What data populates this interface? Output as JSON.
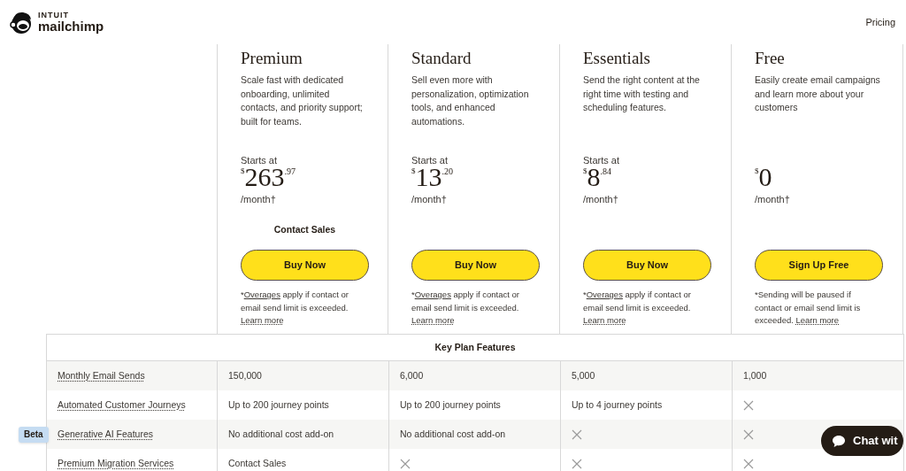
{
  "header": {
    "brand_top": "INTUIT",
    "brand_name": "mailchimp",
    "nav": [
      "Pricing"
    ]
  },
  "plans": [
    {
      "name": "Premium",
      "description": "Scale fast with dedicated onboarding, unlimited contacts, and priority support; built for teams.",
      "starts_at": "Starts at",
      "currency": "$",
      "price": "263",
      "cents": ".97",
      "period": "/month†",
      "contact_sales": "Contact Sales",
      "button": "Buy Now",
      "note_prefix": "*",
      "note_link": "Overages",
      "note_text": " apply if contact or email send limit is exceeded.",
      "learn_more": "Learn more"
    },
    {
      "name": "Standard",
      "description": "Sell even more with personalization, optimization tools, and enhanced automations.",
      "starts_at": "Starts at",
      "currency": "$",
      "price": "13",
      "cents": ".20",
      "period": "/month†",
      "button": "Buy Now",
      "note_prefix": "*",
      "note_link": "Overages",
      "note_text": " apply if contact or email send limit is exceeded.",
      "learn_more": "Learn more"
    },
    {
      "name": "Essentials",
      "description": "Send the right content at the right time with testing and scheduling features.",
      "starts_at": "Starts at",
      "currency": "$",
      "price": "8",
      "cents": ".84",
      "period": "/month†",
      "button": "Buy Now",
      "note_prefix": "*",
      "note_link": "Overages",
      "note_text": " apply if contact or email send limit is exceeded.",
      "learn_more": "Learn more"
    },
    {
      "name": "Free",
      "description": "Easily create email campaigns and learn more about your customers",
      "currency": "$",
      "price": "0",
      "period": "/month†",
      "button": "Sign Up Free",
      "note_text": "*Sending will be paused if contact or email send limit is exceeded.",
      "learn_more": "Learn more"
    }
  ],
  "table": {
    "title": "Key Plan Features",
    "rows": [
      {
        "label": "Monthly Email Sends",
        "cells": [
          {
            "kind": "text",
            "text": "150,000"
          },
          {
            "kind": "text",
            "text": "6,000"
          },
          {
            "kind": "text",
            "text": "5,000"
          },
          {
            "kind": "text",
            "text": "1,000"
          }
        ]
      },
      {
        "label": "Automated Customer Journeys",
        "cells": [
          {
            "kind": "text",
            "text": "Up to 200 journey points"
          },
          {
            "kind": "text",
            "text": "Up to 200 journey points"
          },
          {
            "kind": "text",
            "text": "Up to 4 journey points"
          },
          {
            "kind": "none"
          }
        ]
      },
      {
        "label": "Generative AI Features",
        "badge": "Beta",
        "cells": [
          {
            "kind": "text",
            "text": "No additional cost add-on"
          },
          {
            "kind": "text",
            "text": "No additional cost add-on"
          },
          {
            "kind": "none"
          },
          {
            "kind": "none"
          }
        ]
      },
      {
        "label": "Premium Migration Services",
        "cells": [
          {
            "kind": "text",
            "text": "Contact Sales"
          },
          {
            "kind": "none"
          },
          {
            "kind": "none"
          },
          {
            "kind": "none"
          }
        ]
      }
    ]
  },
  "chat": {
    "label": "Chat wit"
  }
}
